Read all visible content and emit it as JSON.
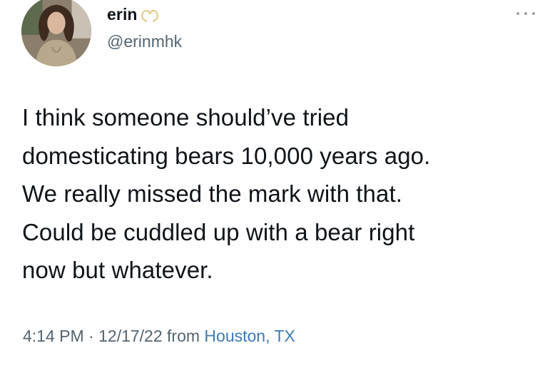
{
  "user": {
    "display_name": "erin",
    "handle": "@erinmhk",
    "name_emoji": "heart-hands-icon",
    "avatar": "profile-photo"
  },
  "tweet": {
    "text_lines": [
      "I think someone should’ve tried",
      "domesticating bears 10,000 years ago.",
      "We really missed the mark with that.",
      "Could be cuddled up with a bear right",
      "now but whatever."
    ],
    "time": "4:14 PM",
    "separator": "·",
    "date": "12/17/22",
    "from_label": "from",
    "location": "Houston, TX"
  },
  "actions": {
    "more_icon": "more-icon"
  },
  "colors": {
    "text": "#0f1419",
    "secondary": "#536471",
    "link": "#3a7bb8"
  }
}
